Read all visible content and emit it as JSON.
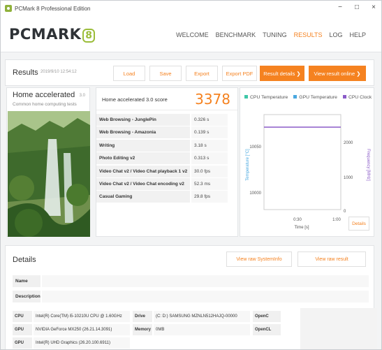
{
  "window": {
    "title": "PCMark 8 Professional Edition",
    "min": "−",
    "max": "□",
    "close": "×"
  },
  "nav": {
    "logo": "PCMARK",
    "logo_badge": "8",
    "items": [
      "WELCOME",
      "BENCHMARK",
      "TUNING",
      "RESULTS",
      "LOG",
      "HELP"
    ],
    "active": "RESULTS"
  },
  "results": {
    "title": "Results",
    "date": "2019/9/10 12:54:12",
    "buttons": {
      "load": "Load",
      "save": "Save",
      "export": "Export",
      "export_pdf": "Export PDF",
      "result_details": "Result details ❯",
      "view_online": "View result online ❯"
    }
  },
  "test": {
    "name": "Home accelerated",
    "version": "3.0",
    "subtitle": "Common home computing tests"
  },
  "score": {
    "label": "Home accelerated 3.0 score",
    "value": "3378",
    "rows": [
      {
        "name": "Web Browsing - JunglePin",
        "value": "0.326 s"
      },
      {
        "name": "Web Browsing - Amazonia",
        "value": "0.139 s"
      },
      {
        "name": "Writing",
        "value": "3.18 s"
      },
      {
        "name": "Photo Editing v2",
        "value": "0.313 s"
      },
      {
        "name": "Video Chat v2 / Video Chat playback 1 v2",
        "value": "30.0 fps"
      },
      {
        "name": "Video Chat v2 / Video Chat encoding v2",
        "value": "52.3 ms"
      },
      {
        "name": "Casual Gaming",
        "value": "29.8 fps"
      }
    ]
  },
  "monitor": {
    "legend": [
      {
        "label": "CPU Temperature",
        "color": "#3fc7a8"
      },
      {
        "label": "GPU Temperature",
        "color": "#4aa8e0"
      },
      {
        "label": "CPU Clock",
        "color": "#8b5cc8"
      }
    ],
    "y_left_label": "Temperature [°C]",
    "y_right_label": "Frequency [MHz]",
    "x_label": "Time [s]",
    "y_left_ticks": [
      "10050",
      "10000"
    ],
    "y_right_ticks": [
      "2000",
      "1000",
      "0"
    ],
    "x_ticks": [
      "0:30",
      "1:00"
    ],
    "details_btn": "Details",
    "chart_data": {
      "type": "line",
      "series": [
        {
          "name": "CPU Clock",
          "x": [
            0,
            65
          ],
          "y": [
            1995,
            1995
          ]
        }
      ],
      "xlabel": "Time [s]",
      "ylabel": "Frequency [MHz]",
      "ylim": [
        0,
        2300
      ],
      "xlim": [
        0,
        65
      ]
    }
  },
  "details": {
    "title": "Details",
    "btn_systeminfo": "View raw SystemInfo",
    "btn_result": "View raw result",
    "name_label": "Name",
    "description_label": "Description",
    "system": [
      {
        "k": "CPU",
        "v": "Intel(R) Core(TM) i5-10210U CPU @ 1.60GHz"
      },
      {
        "k": "GPU",
        "v": "NVIDIA GeForce MX250 (26.21.14.3091)"
      },
      {
        "k": "GPU",
        "v": "Intel(R) UHD Graphics (26.20.100.6911)"
      }
    ],
    "drive_label": "Drive",
    "drive_value": "(C: D:) SAMSUNG MZNLN512HAJQ-00000",
    "memory_label": "Memory",
    "memory_value": "0MB",
    "opencl_1": "OpenC",
    "opencl_2": "OpenCL"
  }
}
